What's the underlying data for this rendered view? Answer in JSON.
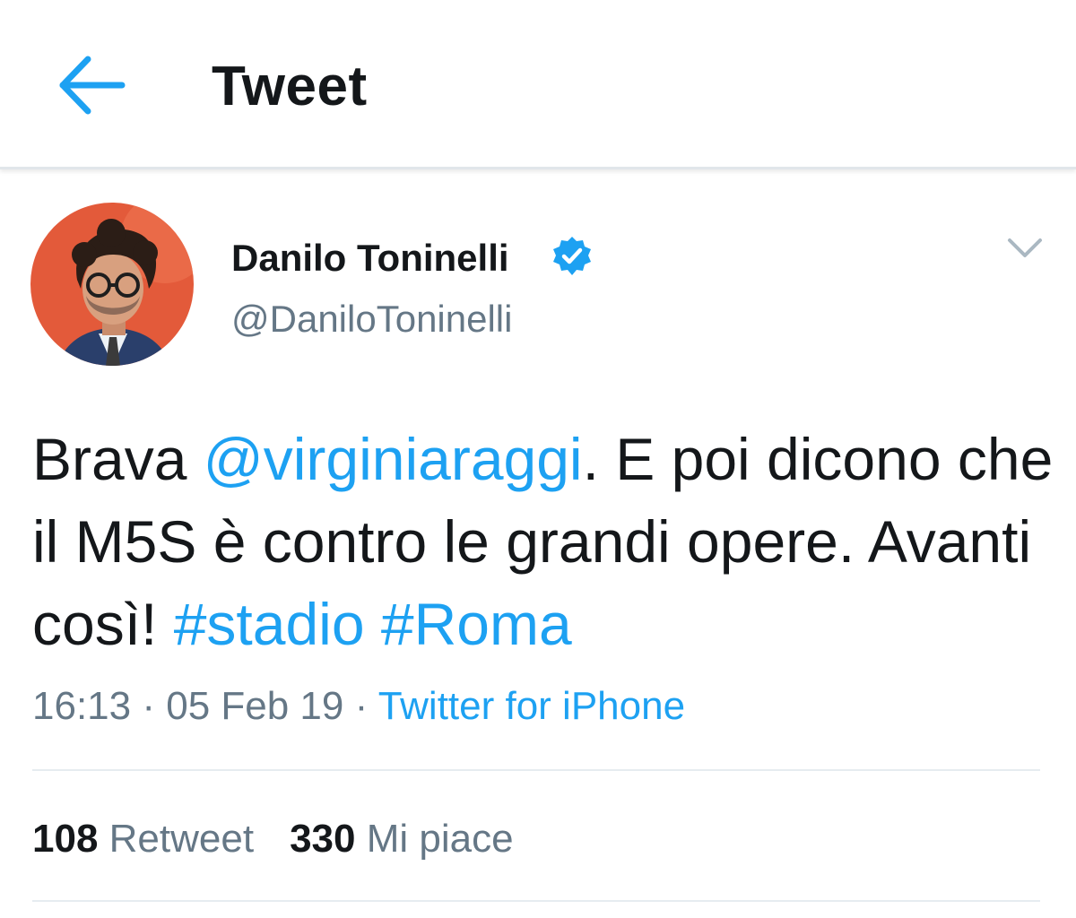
{
  "header": {
    "title": "Tweet",
    "back_icon": "arrow-left-icon",
    "accent_color": "#1da1f2"
  },
  "author": {
    "name": "Danilo Toninelli",
    "handle": "@DaniloToninelli",
    "verified_icon": "verified-badge-icon",
    "menu_icon": "chevron-down-icon"
  },
  "tweet": {
    "text_part1": "Brava ",
    "mention": "@virginiaraggi",
    "text_part2": ". E poi dicono che il M5S è contro le grandi opere. Avanti così! ",
    "hashtag1": "#stadio",
    "text_space": " ",
    "hashtag2": "#Roma"
  },
  "meta": {
    "time": "16:13",
    "separator": " · ",
    "date": "05 Feb 19",
    "separator2": " · ",
    "source": "Twitter for iPhone"
  },
  "stats": {
    "retweet_count": "108",
    "retweet_label": "Retweet",
    "like_count": "330",
    "like_label": "Mi piace"
  },
  "colors": {
    "text_primary": "#14171a",
    "text_secondary": "#657786",
    "link": "#1da1f2",
    "divider": "#e6ecf0",
    "avatar_bg": "#e35a3a"
  }
}
